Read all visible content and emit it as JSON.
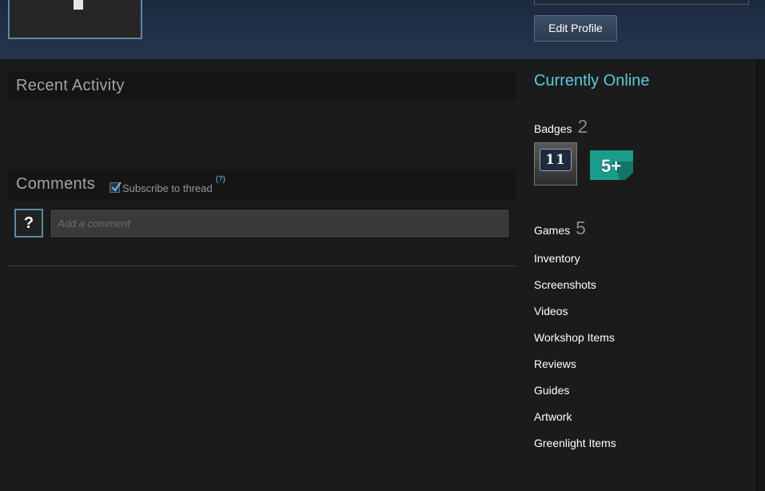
{
  "header": {
    "edit_profile_label": "Edit Profile"
  },
  "recent_activity": {
    "title": "Recent Activity"
  },
  "comments": {
    "title": "Comments",
    "subscribe_label": "Subscribe to thread",
    "subscribe_checked": true,
    "help_label": "(?)",
    "avatar_placeholder": "?",
    "input_placeholder": "Add a comment",
    "input_value": ""
  },
  "sidebar": {
    "status": "Currently Online",
    "badges_label": "Badges",
    "badges_count": "2",
    "badges": [
      {
        "icon": "level-11-badge-icon",
        "text": "11"
      },
      {
        "icon": "years-5-plus-badge-icon",
        "text": "5+"
      }
    ],
    "games_label": "Games",
    "games_count": "5",
    "links": [
      "Inventory",
      "Screenshots",
      "Videos",
      "Workshop Items",
      "Reviews",
      "Guides",
      "Artwork",
      "Greenlight Items"
    ]
  },
  "colors": {
    "status_online": "#57cbde",
    "background": "#1b1b1b",
    "header_background": "#22304a",
    "badge_teal": "#1a9c8c"
  }
}
